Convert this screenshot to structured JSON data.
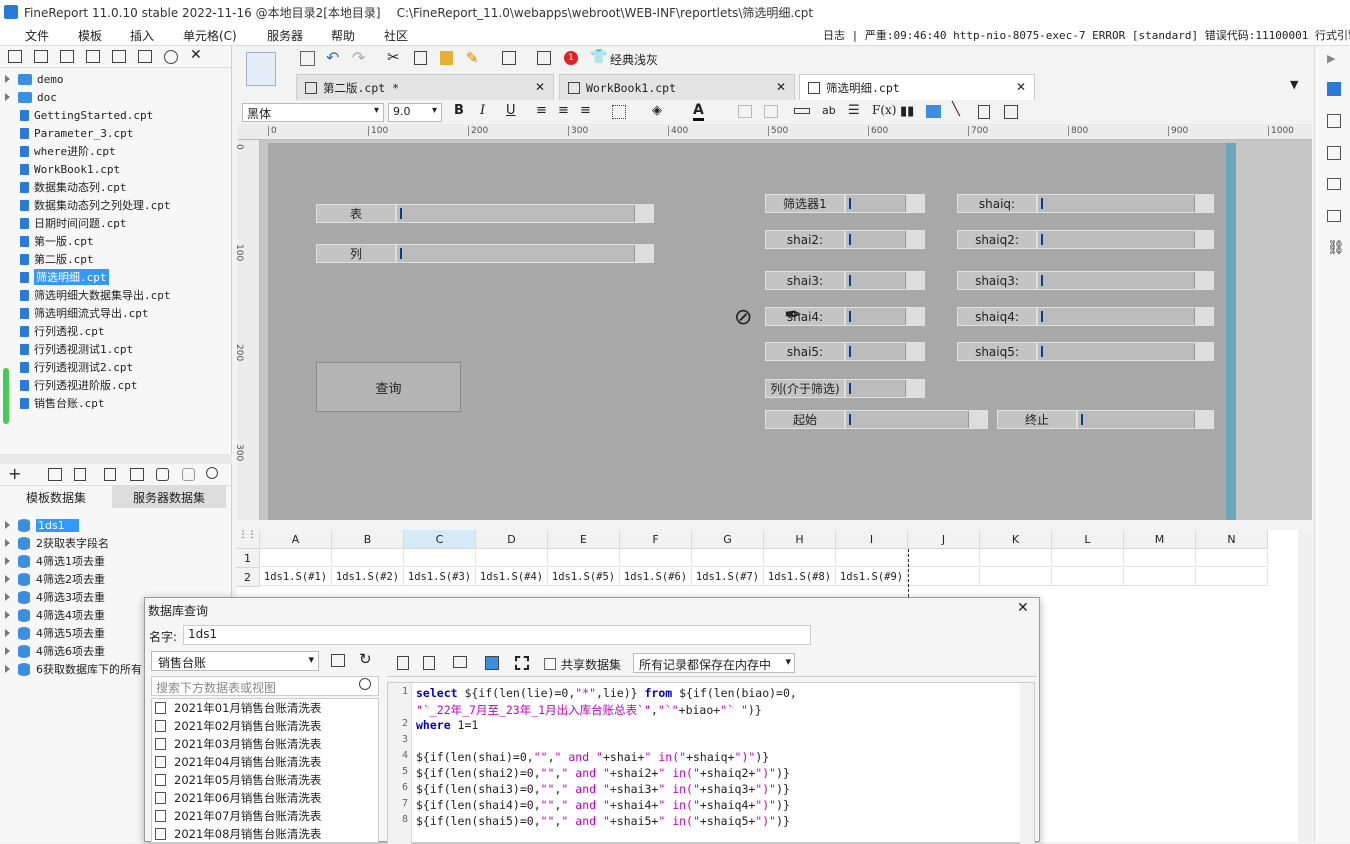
{
  "title": {
    "app": "FineReport 11.0.10 stable 2022-11-16 @本地目录2[本地目录]",
    "path": "C:\\FineReport_11.0\\webapps\\webroot\\WEB-INF\\reportlets\\筛选明细.cpt"
  },
  "menu": [
    "文件",
    "模板",
    "插入",
    "单元格(C)",
    "服务器",
    "帮助",
    "社区"
  ],
  "log": "日志 | 严重:09:46:40 http-nio-8075-exec-7 ERROR [standard] 错误代码:11100001 行式引擎不支",
  "file_tree": [
    {
      "name": "demo",
      "type": "folder"
    },
    {
      "name": "doc",
      "type": "folder"
    },
    {
      "name": "GettingStarted.cpt",
      "type": "file"
    },
    {
      "name": "Parameter_3.cpt",
      "type": "file"
    },
    {
      "name": "where进阶.cpt",
      "type": "file"
    },
    {
      "name": "WorkBook1.cpt",
      "type": "file"
    },
    {
      "name": "数据集动态列.cpt",
      "type": "file"
    },
    {
      "name": "数据集动态列之列处理.cpt",
      "type": "file"
    },
    {
      "name": "日期时间问题.cpt",
      "type": "file"
    },
    {
      "name": "第一版.cpt",
      "type": "file"
    },
    {
      "name": "第二版.cpt",
      "type": "file"
    },
    {
      "name": "筛选明细.cpt",
      "type": "file",
      "selected": true
    },
    {
      "name": "筛选明细大数据集导出.cpt",
      "type": "file"
    },
    {
      "name": "筛选明细流式导出.cpt",
      "type": "file"
    },
    {
      "name": "行列透视.cpt",
      "type": "file"
    },
    {
      "name": "行列透视测试1.cpt",
      "type": "file"
    },
    {
      "name": "行列透视测试2.cpt",
      "type": "file"
    },
    {
      "name": "行列透视进阶版.cpt",
      "type": "file"
    },
    {
      "name": "销售台账.cpt",
      "type": "file"
    }
  ],
  "dataset_tabs": [
    "模板数据集",
    "服务器数据集"
  ],
  "datasets": [
    "1ds1",
    "2获取表字段名",
    "4筛选1项去重",
    "4筛选2项去重",
    "4筛选3项去重",
    "4筛选4项去重",
    "4筛选5项去重",
    "4筛选6项去重",
    "6获取数据库下的所有"
  ],
  "toolbar": {
    "classic_gray": "经典浅灰",
    "badge": "1"
  },
  "tabs": [
    {
      "label": "第二版.cpt *",
      "active": false
    },
    {
      "label": "WorkBook1.cpt",
      "active": false
    },
    {
      "label": "筛选明细.cpt",
      "active": true
    }
  ],
  "format": {
    "font": "黑体",
    "size": "9.0",
    "fx": "F(x)",
    "ab": "ab"
  },
  "ruler": [
    "0",
    "100",
    "200",
    "300",
    "400",
    "500",
    "600",
    "700",
    "800",
    "900",
    "1000"
  ],
  "vruler": [
    "0",
    "100",
    "200",
    "300"
  ],
  "params": {
    "table_label": "表",
    "column_label": "列",
    "query_button": "查询",
    "rows": [
      {
        "l1": "筛选器1",
        "l2": "shaiq:"
      },
      {
        "l1": "shai2:",
        "l2": "shaiq2:"
      },
      {
        "l1": "shai3:",
        "l2": "shaiq3:"
      },
      {
        "l1": "shai4:",
        "l2": "shaiq4:"
      },
      {
        "l1": "shai5:",
        "l2": "shaiq5:"
      }
    ],
    "between_label": "列(介于筛选)",
    "start_label": "起始",
    "end_label": "终止"
  },
  "sheet": {
    "columns": [
      "A",
      "B",
      "C",
      "D",
      "E",
      "F",
      "G",
      "H",
      "I",
      "J",
      "K",
      "L",
      "M",
      "N"
    ],
    "rows": [
      "1",
      "2"
    ],
    "row2": [
      "1ds1.S(#1)",
      "1ds1.S(#2)",
      "1ds1.S(#3)",
      "1ds1.S(#4)",
      "1ds1.S(#5)",
      "1ds1.S(#6)",
      "1ds1.S(#7)",
      "1ds1.S(#8)",
      "1ds1.S(#9)"
    ]
  },
  "dialog": {
    "title": "数据库查询",
    "name_label": "名字:",
    "name_value": "1ds1",
    "connection": "销售台账",
    "search_placeholder": "搜索下方数据表或视图",
    "share_label": "共享数据集",
    "storage": "所有记录都保存在内存中",
    "tables": [
      "2021年01月销售台账清洗表",
      "2021年02月销售台账清洗表",
      "2021年03月销售台账清洗表",
      "2021年04月销售台账清洗表",
      "2021年05月销售台账清洗表",
      "2021年06月销售台账清洗表",
      "2021年07月销售台账清洗表",
      "2021年08月销售台账清洗表"
    ],
    "sql": [
      {
        "n": "1",
        "parts": [
          [
            "kw",
            "select"
          ],
          [
            "t",
            " ${if(len(lie)=0,"
          ],
          [
            "str",
            "\"*\""
          ],
          [
            "t",
            ",lie)} "
          ],
          [
            "kw",
            "from"
          ],
          [
            "t",
            " ${if(len(biao)=0,"
          ]
        ]
      },
      {
        "n": "",
        "parts": [
          [
            "str",
            "\"`_22年_7月至_23年_1月出入库台账总表`\""
          ],
          [
            "t",
            ","
          ],
          [
            "str",
            "\"`\""
          ],
          [
            "t",
            "+biao+"
          ],
          [
            "str",
            "\"` \""
          ],
          [
            "t",
            ")}"
          ]
        ]
      },
      {
        "n": "2",
        "parts": [
          [
            "kw",
            "where"
          ],
          [
            "t",
            " 1=1"
          ]
        ]
      },
      {
        "n": "3",
        "parts": []
      },
      {
        "n": "4",
        "parts": [
          [
            "t",
            "${if(len(shai)=0,"
          ],
          [
            "str",
            "\"\""
          ],
          [
            "t",
            ","
          ],
          [
            "str",
            "\" and \""
          ],
          [
            "t",
            "+shai+"
          ],
          [
            "str",
            "\" in(\""
          ],
          [
            "t",
            "+shaiq+"
          ],
          [
            "str",
            "\")\""
          ],
          [
            "t",
            ")}"
          ]
        ]
      },
      {
        "n": "5",
        "parts": [
          [
            "t",
            "${if(len(shai2)=0,"
          ],
          [
            "str",
            "\"\""
          ],
          [
            "t",
            ","
          ],
          [
            "str",
            "\" and \""
          ],
          [
            "t",
            "+shai2+"
          ],
          [
            "str",
            "\" in(\""
          ],
          [
            "t",
            "+shaiq2+"
          ],
          [
            "str",
            "\")\""
          ],
          [
            "t",
            ")}"
          ]
        ]
      },
      {
        "n": "6",
        "parts": [
          [
            "t",
            "${if(len(shai3)=0,"
          ],
          [
            "str",
            "\"\""
          ],
          [
            "t",
            ","
          ],
          [
            "str",
            "\" and \""
          ],
          [
            "t",
            "+shai3+"
          ],
          [
            "str",
            "\" in(\""
          ],
          [
            "t",
            "+shaiq3+"
          ],
          [
            "str",
            "\")\""
          ],
          [
            "t",
            ")}"
          ]
        ]
      },
      {
        "n": "7",
        "parts": [
          [
            "t",
            "${if(len(shai4)=0,"
          ],
          [
            "str",
            "\"\""
          ],
          [
            "t",
            ","
          ],
          [
            "str",
            "\" and \""
          ],
          [
            "t",
            "+shai4+"
          ],
          [
            "str",
            "\" in(\""
          ],
          [
            "t",
            "+shaiq4+"
          ],
          [
            "str",
            "\")\""
          ],
          [
            "t",
            ")}"
          ]
        ]
      },
      {
        "n": "8",
        "parts": [
          [
            "t",
            "${if(len(shai5)=0,"
          ],
          [
            "str",
            "\"\""
          ],
          [
            "t",
            ","
          ],
          [
            "str",
            "\" and \""
          ],
          [
            "t",
            "+shai5+"
          ],
          [
            "str",
            "\" in(\""
          ],
          [
            "t",
            "+shaiq5+"
          ],
          [
            "str",
            "\")\""
          ],
          [
            "t",
            ")}"
          ]
        ]
      }
    ]
  },
  "colors": {
    "accent": "#2a7bd6",
    "selection": "#3399ff",
    "canvas": "#a8a8a8",
    "keyword": "#0000c8",
    "string": "#c000c0"
  }
}
